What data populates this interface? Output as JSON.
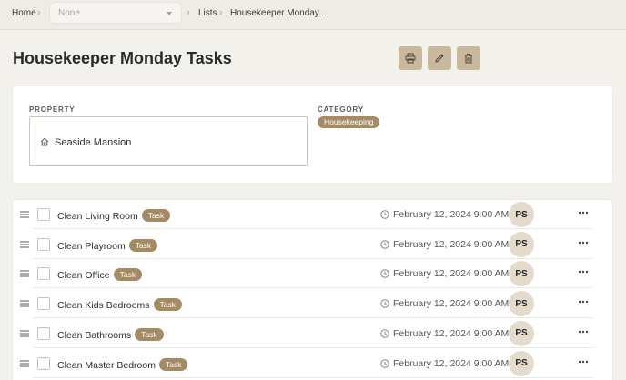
{
  "breadcrumb": {
    "home": "Home",
    "select_value": "None",
    "lists": "Lists",
    "current": "Housekeeper Monday..."
  },
  "page": {
    "title": "Housekeeper Monday Tasks"
  },
  "toolbar": {
    "icons": [
      "printer-icon",
      "pencil-icon",
      "trash-icon"
    ]
  },
  "details": {
    "property_label": "PROPERTY",
    "property_value": "Seaside Mansion",
    "category_label": "CATEGORY",
    "category_value": "Housekeeping"
  },
  "tasks": [
    {
      "name": "Clean Living Room",
      "tag": "Task",
      "due": "February 12, 2024 9:00 AM",
      "assignee": "PS"
    },
    {
      "name": "Clean Playroom",
      "tag": "Task",
      "due": "February 12, 2024 9:00 AM",
      "assignee": "PS"
    },
    {
      "name": "Clean Office",
      "tag": "Task",
      "due": "February 12, 2024 9:00 AM",
      "assignee": "PS"
    },
    {
      "name": "Clean Kids Bedrooms",
      "tag": "Task",
      "due": "February 12, 2024 9:00 AM",
      "assignee": "PS"
    },
    {
      "name": "Clean Bathrooms",
      "tag": "Task",
      "due": "February 12, 2024 9:00 AM",
      "assignee": "PS"
    },
    {
      "name": "Clean Master Bedroom",
      "tag": "Task",
      "due": "February 12, 2024 9:00 AM",
      "assignee": "PS"
    }
  ],
  "colors": {
    "accent": "#a48b64",
    "button": "#c9b89c",
    "avatar": "#e4dbcc",
    "background": "#f3f1ec"
  }
}
